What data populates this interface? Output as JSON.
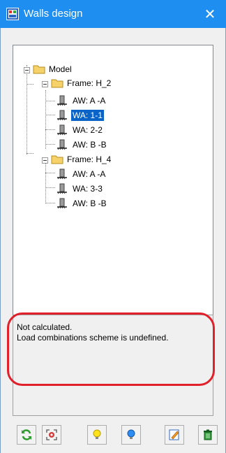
{
  "window": {
    "title": "Walls design",
    "close_glyph": "✕"
  },
  "tree": {
    "root": {
      "label": "Model",
      "icon": "folder-icon"
    },
    "frames": [
      {
        "label": "Frame: H_2",
        "icon": "folder-icon",
        "items": [
          {
            "label": "AW: A -A",
            "icon": "wall-icon"
          },
          {
            "label": "WA: 1-1",
            "icon": "wall-icon",
            "selected": true
          },
          {
            "label": "WA: 2-2",
            "icon": "wall-icon"
          },
          {
            "label": "AW: B -B",
            "icon": "wall-icon"
          }
        ]
      },
      {
        "label": "Frame: H_4",
        "icon": "folder-icon",
        "items": [
          {
            "label": "AW: A -A",
            "icon": "wall-icon"
          },
          {
            "label": "WA: 3-3",
            "icon": "wall-icon"
          },
          {
            "label": "AW: B -B",
            "icon": "wall-icon"
          }
        ]
      }
    ]
  },
  "status": {
    "lines": [
      "Not calculated.",
      "Load combinations scheme is undefined."
    ]
  },
  "toolbar": {
    "buttons": [
      {
        "icon": "refresh-icon"
      },
      {
        "icon": "target-icon"
      },
      {
        "icon": "bulb-yellow-icon"
      },
      {
        "icon": "bulb-blue-icon"
      },
      {
        "icon": "edit-icon"
      },
      {
        "icon": "trash-icon"
      }
    ]
  },
  "colors": {
    "title_bar": "#1e8ff0",
    "selection": "#0a64c8",
    "annotation_ring": "#e0202a"
  }
}
